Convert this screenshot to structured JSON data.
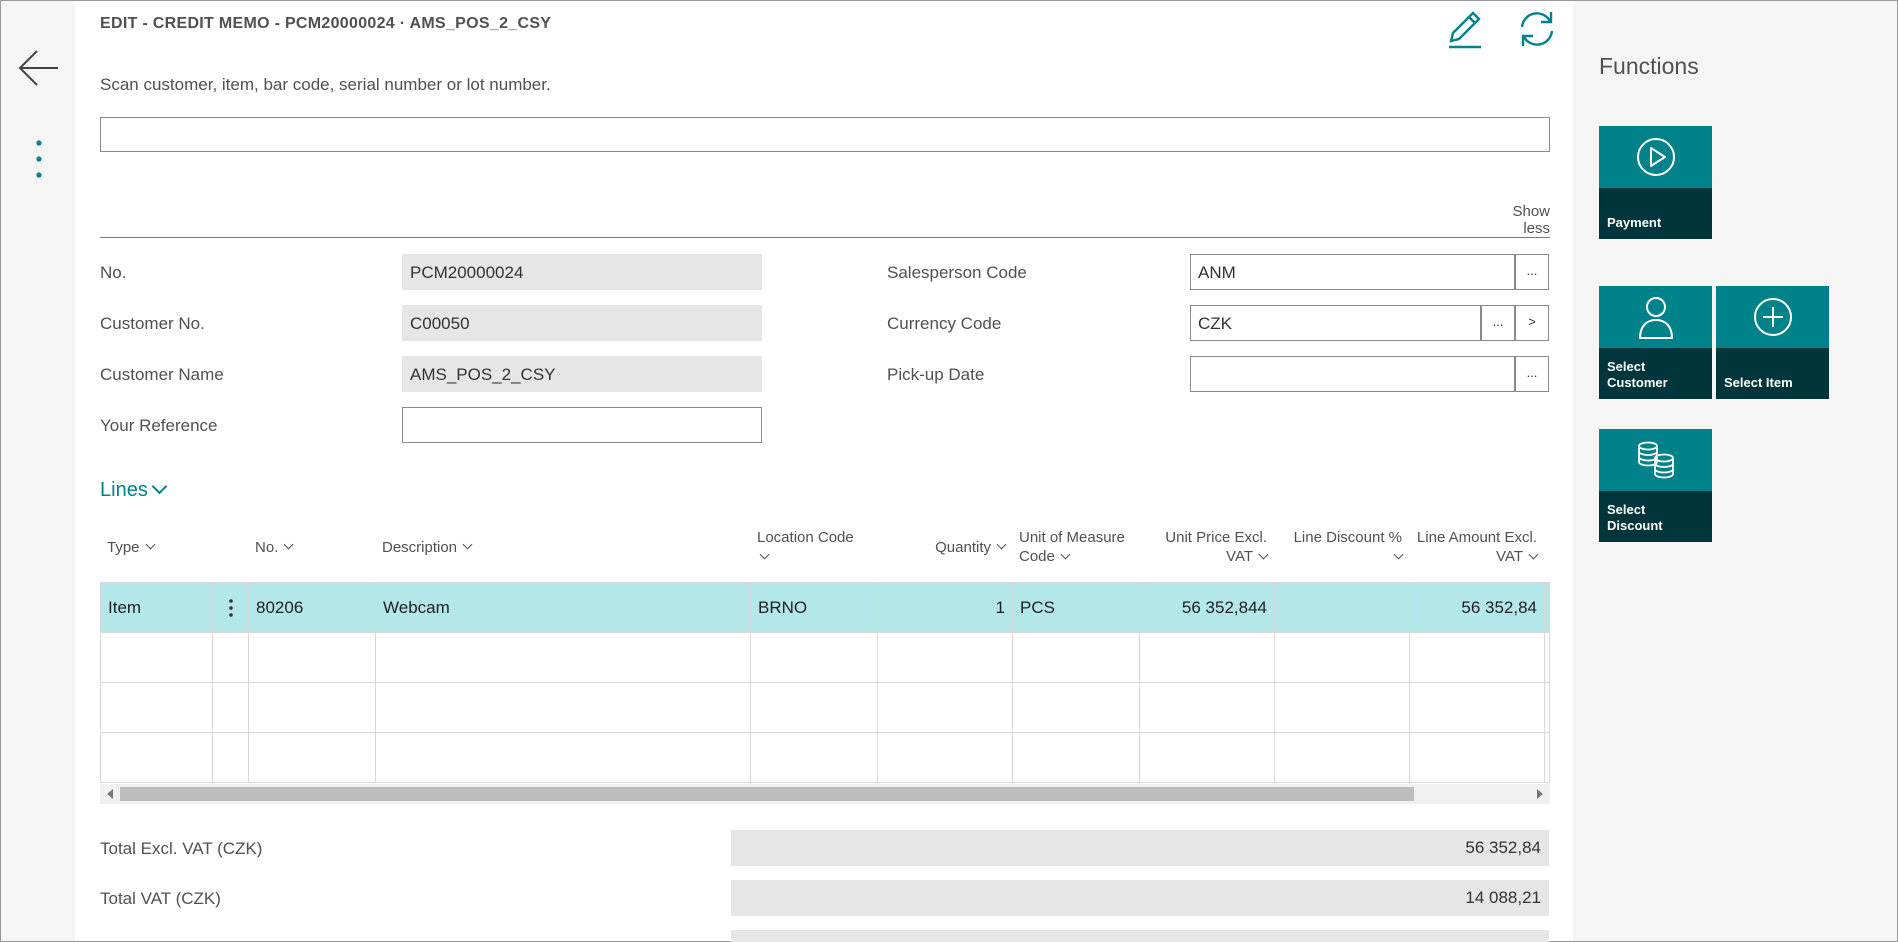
{
  "header": {
    "title": "EDIT - CREDIT MEMO - PCM20000024 · AMS_POS_2_CSY"
  },
  "scan": {
    "label": "Scan customer, item, bar code, serial number or lot number.",
    "value": ""
  },
  "show_less_label": "Show less",
  "fields": {
    "no": {
      "label": "No.",
      "value": "PCM20000024"
    },
    "customer_no": {
      "label": "Customer No.",
      "value": "C00050"
    },
    "customer_name": {
      "label": "Customer Name",
      "value": "AMS_POS_2_CSY"
    },
    "your_reference": {
      "label": "Your Reference",
      "value": ""
    },
    "salesperson_code": {
      "label": "Salesperson Code",
      "value": "ANM"
    },
    "currency_code": {
      "label": "Currency Code",
      "value": "CZK"
    },
    "pickup_date": {
      "label": "Pick-up Date",
      "value": ""
    },
    "lookup_label": "...",
    "drill_label": ">"
  },
  "lines": {
    "title": "Lines",
    "columns": {
      "type": "Type",
      "no": "No.",
      "description": "Description",
      "location_code": "Location Code",
      "quantity": "Quantity",
      "uom_line1": "Unit of Measure",
      "uom_line2": "Code",
      "unit_price_line1": "Unit Price Excl.",
      "unit_price_line2": "VAT",
      "line_discount": "Line Discount %",
      "line_amount_line1": "Line Amount Excl.",
      "line_amount_line2": "VAT"
    },
    "rows": [
      {
        "type": "Item",
        "no": "80206",
        "description": "Webcam",
        "location_code": "BRNO",
        "quantity": "1",
        "uom": "PCS",
        "unit_price": "56 352,844",
        "line_discount": "",
        "line_amount": "56 352,84"
      }
    ]
  },
  "totals": {
    "excl_vat": {
      "label": "Total Excl. VAT (CZK)",
      "value": "56 352,84"
    },
    "vat": {
      "label": "Total VAT (CZK)",
      "value": "14 088,21"
    }
  },
  "functions": {
    "title": "Functions",
    "payment": "Payment",
    "select_customer_1": "Select",
    "select_customer_2": "Customer",
    "select_item": "Select Item",
    "select_discount_1": "Select",
    "select_discount_2": "Discount"
  },
  "colors": {
    "accent": "#00828a",
    "tile_dark": "#00363b",
    "selected_row": "#b4e7ea"
  },
  "icons": {
    "back": "arrow-left-icon",
    "more": "vertical-dots-icon",
    "edit": "pencil-icon",
    "refresh": "refresh-icon",
    "payment": "play-circle-icon",
    "customer": "person-icon",
    "item": "plus-circle-icon",
    "discount": "coins-icon"
  }
}
